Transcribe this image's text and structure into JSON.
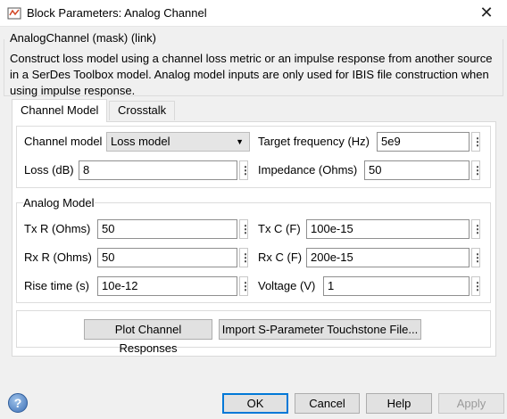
{
  "window": {
    "title": "Block Parameters: Analog Channel"
  },
  "mask_title": "AnalogChannel (mask) (link)",
  "description": "Construct loss model using a channel loss metric or an impulse response from another source in a SerDes Toolbox model.  Analog model inputs are only used for IBIS file construction when using impulse response.",
  "tabs": [
    {
      "label": "Channel Model",
      "active": true
    },
    {
      "label": "Crosstalk",
      "active": false
    }
  ],
  "channel": {
    "channel_model_label": "Channel model",
    "channel_model_value": "Loss model",
    "target_frequency_label": "Target frequency (Hz)",
    "target_frequency_value": "5e9",
    "loss_label": "Loss (dB)",
    "loss_value": "8",
    "impedance_label": "Impedance (Ohms)",
    "impedance_value": "50"
  },
  "analog": {
    "group_title": "Analog Model",
    "tx_r_label": "Tx R (Ohms)",
    "tx_r_value": "50",
    "tx_c_label": "Tx C (F)",
    "tx_c_value": "100e-15",
    "rx_r_label": "Rx R (Ohms)",
    "rx_r_value": "50",
    "rx_c_label": "Rx C (F)",
    "rx_c_value": "200e-15",
    "rise_time_label": "Rise time (s)",
    "rise_time_value": "10e-12",
    "voltage_label": "Voltage (V)",
    "voltage_value": "1"
  },
  "actions": {
    "plot_label": "Plot Channel Responses",
    "import_label": "Import S-Parameter Touchstone File..."
  },
  "footer": {
    "ok_label": "OK",
    "cancel_label": "Cancel",
    "help_label": "Help",
    "apply_label": "Apply"
  },
  "icons": {
    "title_icon": "simulink-block-icon",
    "close_icon": "close-icon",
    "menu_icon": "kebab-menu-icon",
    "help_icon": "help-question-icon",
    "dropdown_icon": "chevron-down-icon"
  },
  "colors": {
    "focus_border": "#0078d7",
    "dialog_bg": "#f0f0f0",
    "panel_bg": "#ffffff"
  }
}
